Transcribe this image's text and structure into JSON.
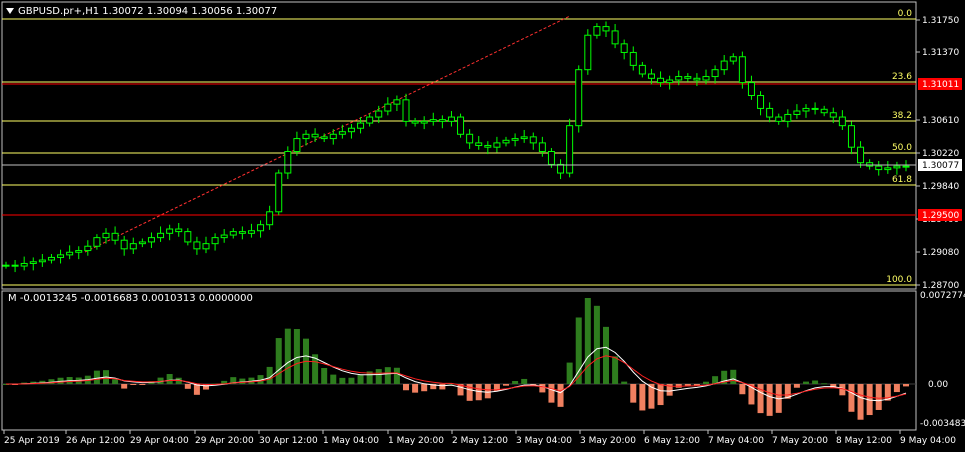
{
  "header": {
    "symbol": "GBPUSD.pr+,H1",
    "ohlc": "1.30072 1.30094 1.30056 1.30077"
  },
  "indicator": {
    "label": "M",
    "values": "-0.0013245 -0.0016683 0.0010313 0.0000000"
  },
  "price_axis": {
    "ticks": [
      "1.31750",
      "1.31370",
      "1.30610",
      "1.30220",
      "1.29840",
      "1.29460",
      "1.29080",
      "1.28700"
    ],
    "current_price": "1.30077",
    "hline_upper": "1.31011",
    "hline_lower": "1.29500"
  },
  "fib_levels": [
    "0.0",
    "23.6",
    "38.2",
    "50.0",
    "61.8",
    "100.0"
  ],
  "indicator_axis": {
    "top": "0.0072774",
    "zero": "0.00",
    "bottom": "-0.003483"
  },
  "time_axis": [
    "25 Apr 2019",
    "26 Apr 12:00",
    "29 Apr 04:00",
    "29 Apr 20:00",
    "30 Apr 12:00",
    "1 May 04:00",
    "1 May 20:00",
    "2 May 12:00",
    "3 May 04:00",
    "3 May 20:00",
    "6 May 12:00",
    "7 May 04:00",
    "7 May 20:00",
    "8 May 12:00",
    "9 May 04:00"
  ],
  "colors": {
    "candle": "#00ff00",
    "fib": "#ffff66",
    "hline": "#ff0000",
    "hist_pos": "#2e7d1e",
    "hist_neg": "#f08060",
    "signal_white": "#ffffff",
    "signal_red": "#ff2020"
  },
  "chart_data": {
    "type": "candlestick",
    "series": [
      {
        "name": "GBPUSD.pr+,H1",
        "values": [
          1.2893,
          1.2892,
          1.2895,
          1.2897,
          1.2899,
          1.2902,
          1.2905,
          1.2908,
          1.291,
          1.2915,
          1.2925,
          1.293,
          1.2922,
          1.2912,
          1.2918,
          1.292,
          1.2925,
          1.293,
          1.2935,
          1.2932,
          1.292,
          1.2912,
          1.2918,
          1.2925,
          1.2928,
          1.2932,
          1.293,
          1.2933,
          1.294,
          1.2955,
          1.3,
          1.3025,
          1.304,
          1.3045,
          1.3042,
          1.304,
          1.3045,
          1.3048,
          1.3052,
          1.3058,
          1.3065,
          1.3072,
          1.308,
          1.3085,
          1.306,
          1.3058,
          1.306,
          1.3062,
          1.306,
          1.3065,
          1.3045,
          1.3035,
          1.3032,
          1.303,
          1.3035,
          1.3038,
          1.304,
          1.3042,
          1.3035,
          1.3025,
          1.301,
          1.3,
          1.3055,
          1.312,
          1.316,
          1.317,
          1.3165,
          1.315,
          1.314,
          1.3125,
          1.3115,
          1.311,
          1.3105,
          1.3108,
          1.3112,
          1.311,
          1.3108,
          1.3112,
          1.312,
          1.313,
          1.3135,
          1.3105,
          1.309,
          1.3075,
          1.3065,
          1.306,
          1.3068,
          1.3072,
          1.3075,
          1.3074,
          1.307,
          1.3065,
          1.3055,
          1.303,
          1.3012,
          1.3008,
          1.3004,
          1.3006,
          1.3008,
          1.3008
        ]
      }
    ],
    "ylim": [
      1.287,
      1.318
    ]
  }
}
